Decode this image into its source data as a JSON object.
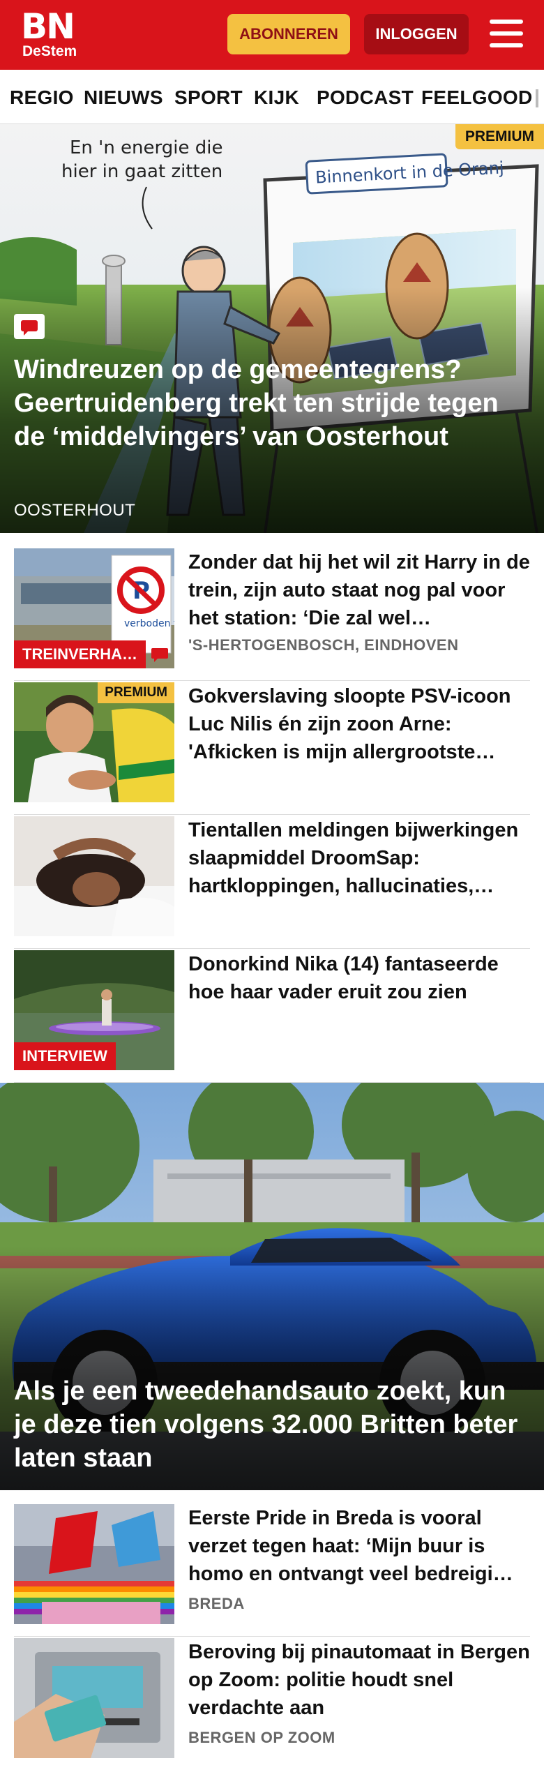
{
  "header": {
    "logo_main": "BN",
    "logo_sub": "DeStem",
    "subscribe_label": "ABONNEREN",
    "login_label": "INLOGGEN",
    "menu_icon": "hamburger-menu-icon",
    "brand_color": "#d9141b",
    "subscribe_color": "#f4c141"
  },
  "nav": {
    "items": [
      "REGIO",
      "NIEUWS",
      "SPORT",
      "KIJK",
      "PODCAST",
      "FEELGOOD"
    ]
  },
  "hero1": {
    "premium": "PREMIUM",
    "cartoon_bubble_line1": "En 'n energie die",
    "cartoon_bubble_line2": "hier in gaat zitten",
    "cartoon_sign": "Binnenkort in de Oranj",
    "title": "Windreuzen op de gemeentegrens? Geertruidenberg trekt ten strijde tegen de ‘middelvingers’ van Oosterhout",
    "region": "OOSTERHOUT",
    "comment_icon": "comment-icon"
  },
  "articles_a": [
    {
      "title": "Zonder dat hij het wil zit Harry in de trein, zijn auto staat nog pal voor het station: ‘Die zal wel…",
      "region": "'S-HERTOGENBOSCH, EINDHOVEN",
      "label": "TREINVERHA…",
      "thumb_sign": "verboden te"
    },
    {
      "title": "Gokverslaving sloopte PSV-icoon Luc Nilis én zijn zoon Arne: 'Afkicken is mijn allergrootste…",
      "premium": "PREMIUM"
    },
    {
      "title": "Tientallen meldingen bijwerkin­gen slaapmiddel DroomSap: hartkloppingen, hallucinaties,…"
    },
    {
      "title": "Donorkind Nika (14) fantaseerde hoe haar vader eruit zou zien",
      "label": "INTERVIEW"
    }
  ],
  "hero2": {
    "title": "Als je een tweedehandsauto zoekt, kun je deze tien volgens 32.000 Britten beter laten staan"
  },
  "articles_b": [
    {
      "title": "Eerste Pride in Breda is vooral verzet tegen haat: ‘Mijn buur is homo en ontvangt veel bedreigi…",
      "region": "BREDA"
    },
    {
      "title": "Beroving bij pinautomaat in Bergen op Zoom: politie houdt snel verdachte aan",
      "region": "BERGEN OP ZOOM"
    }
  ]
}
